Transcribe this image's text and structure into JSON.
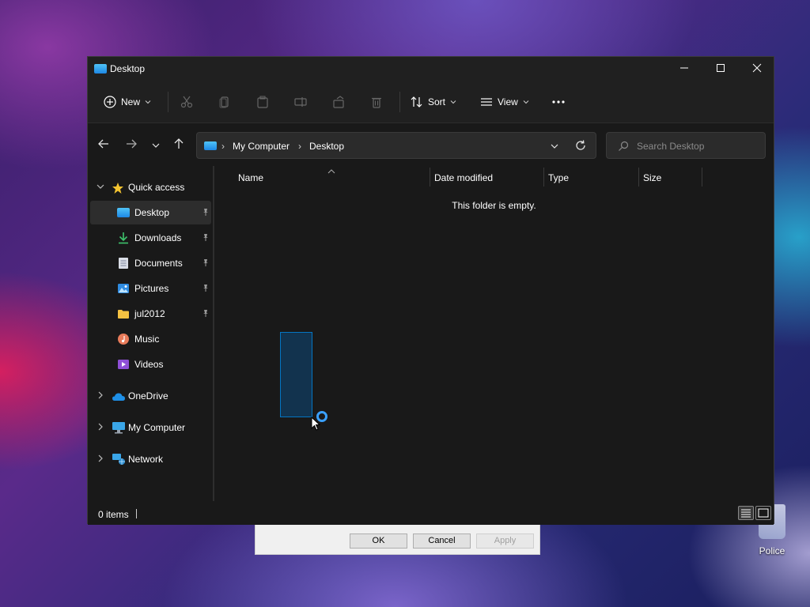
{
  "window": {
    "title": "Desktop"
  },
  "toolbar": {
    "new_label": "New",
    "sort_label": "Sort",
    "view_label": "View"
  },
  "address": {
    "crumbs": [
      "My Computer",
      "Desktop"
    ],
    "search_placeholder": "Search Desktop"
  },
  "sidebar": {
    "quick_access": "Quick access",
    "items": [
      {
        "label": "Desktop",
        "icon": "desktop-icon",
        "pinned": true,
        "selected": true
      },
      {
        "label": "Downloads",
        "icon": "download-icon",
        "pinned": true
      },
      {
        "label": "Documents",
        "icon": "document-icon",
        "pinned": true
      },
      {
        "label": "Pictures",
        "icon": "picture-icon",
        "pinned": true
      },
      {
        "label": "jul2012",
        "icon": "folder-icon",
        "pinned": true
      },
      {
        "label": "Music",
        "icon": "music-icon",
        "pinned": false
      },
      {
        "label": "Videos",
        "icon": "video-icon",
        "pinned": false
      }
    ],
    "roots": [
      {
        "label": "OneDrive",
        "icon": "cloud-icon"
      },
      {
        "label": "My Computer",
        "icon": "computer-icon"
      },
      {
        "label": "Network",
        "icon": "network-icon"
      }
    ]
  },
  "columns": {
    "name": "Name",
    "date_modified": "Date modified",
    "type": "Type",
    "size": "Size"
  },
  "content": {
    "empty_message": "This folder is empty."
  },
  "status": {
    "items": "0 items"
  },
  "background_dialog": {
    "ok": "OK",
    "cancel": "Cancel",
    "apply": "Apply"
  },
  "desktop": {
    "recycle_label": "Police"
  },
  "colors": {
    "accent": "#0078d7",
    "window_bg": "#191919",
    "toolbar_bg": "#202020"
  }
}
